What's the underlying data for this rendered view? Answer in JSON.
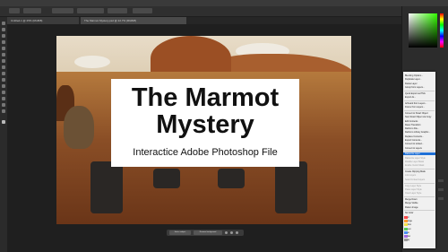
{
  "title_card": {
    "line1": "The Marmot",
    "line2": "Mystery",
    "subtitle": "Interactice Adobe Photoshop File"
  },
  "doc_tabs": [
    "Untitled-1 @ 25% (RGB/8)",
    "The Marmot Mystery.psd @ 22.7% (RGB/8)"
  ],
  "context_bar": {
    "select_label": "Select subject",
    "remove_label": "Remove background"
  },
  "context_menu": {
    "items": [
      {
        "label": "Blending Options...",
        "state": "normal"
      },
      {
        "label": "Duplicate Layer...",
        "state": "normal"
      },
      {
        "label": "Delete Layer",
        "state": "normal"
      },
      {
        "label": "Group from Layers...",
        "state": "normal"
      },
      {
        "label": "Quick Export as PNG",
        "state": "normal"
      },
      {
        "label": "Export As...",
        "state": "normal"
      },
      {
        "label": "Artboard from Layers...",
        "state": "normal"
      },
      {
        "label": "Frame from Layers...",
        "state": "normal"
      },
      {
        "label": "Convert to Smart Object",
        "state": "normal"
      },
      {
        "label": "New Smart Object via Copy",
        "state": "normal"
      },
      {
        "label": "Edit Contents",
        "state": "normal"
      },
      {
        "label": "Reset Transform",
        "state": "normal"
      },
      {
        "label": "Relink to File...",
        "state": "normal"
      },
      {
        "label": "Relink to Library Graphic...",
        "state": "normal"
      },
      {
        "label": "Replace Contents...",
        "state": "normal"
      },
      {
        "label": "Export Contents...",
        "state": "normal"
      },
      {
        "label": "Convert to Linked...",
        "state": "normal"
      },
      {
        "label": "Convert to Layers",
        "state": "normal"
      },
      {
        "label": "Rasterize Layer",
        "state": "highlighted"
      },
      {
        "label": "Rasterize Layer Style",
        "state": "disabled"
      },
      {
        "label": "Disable Layer Mask",
        "state": "disabled"
      },
      {
        "label": "Enable Vector Mask",
        "state": "disabled"
      },
      {
        "label": "Create Clipping Mask",
        "state": "normal"
      },
      {
        "label": "Link Layers",
        "state": "disabled"
      },
      {
        "label": "Select Linked Layers",
        "state": "disabled"
      },
      {
        "label": "Copy Layer Style",
        "state": "disabled"
      },
      {
        "label": "Paste Layer Style",
        "state": "disabled"
      },
      {
        "label": "Clear Layer Style",
        "state": "disabled"
      },
      {
        "label": "Merge Down",
        "state": "normal"
      },
      {
        "label": "Merge Visible",
        "state": "normal"
      },
      {
        "label": "Flatten Image",
        "state": "normal"
      },
      {
        "label": "No Color",
        "state": "normal"
      },
      {
        "label": "Red",
        "state": "normal"
      },
      {
        "label": "Orange",
        "state": "normal"
      },
      {
        "label": "Yellow",
        "state": "normal"
      },
      {
        "label": "Green",
        "state": "normal"
      },
      {
        "label": "Blue",
        "state": "normal"
      },
      {
        "label": "Violet",
        "state": "normal"
      },
      {
        "label": "Gray",
        "state": "normal"
      }
    ]
  },
  "swatch_colors": [
    "#ff4b4b",
    "#ff9a2e",
    "#f5e04a",
    "#57c95a",
    "#4a8ff0",
    "#a36be0",
    "#9a9a9a"
  ],
  "colors": {
    "highlight": "#1e6fd6",
    "app_bg": "#282828"
  }
}
